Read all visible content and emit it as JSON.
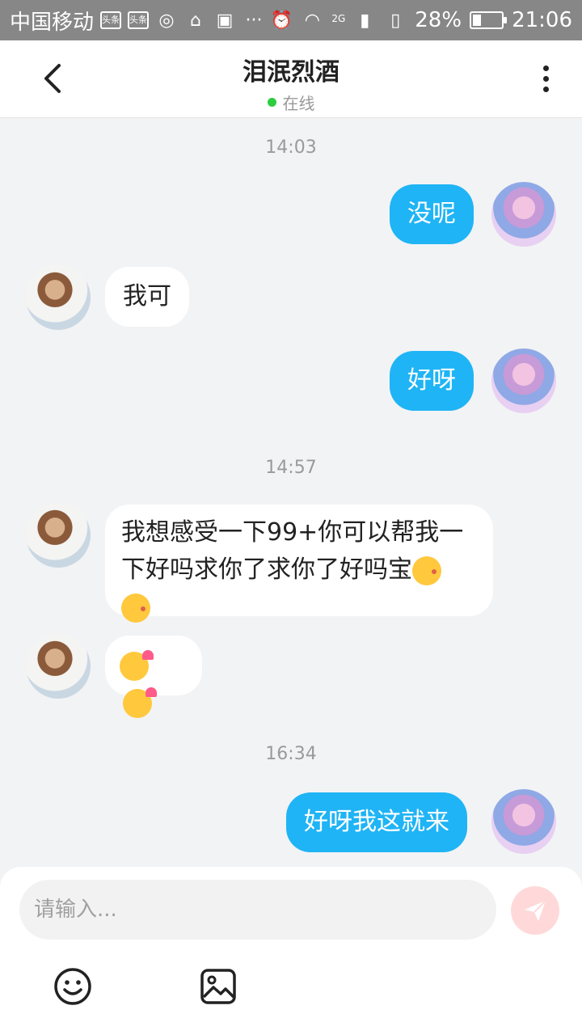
{
  "status_bar": {
    "carrier": "中国移动",
    "badge_1": "头条",
    "badge_2": "头条",
    "network": "2G",
    "battery": "28%",
    "battery_level": 0.28,
    "time": "21:06"
  },
  "header": {
    "title": "泪泯烈酒",
    "status": "在线"
  },
  "messages": {
    "ts1": "14:03",
    "m1": "没呢",
    "m2": "我可",
    "m3": "好呀",
    "ts2": "14:57",
    "m4": "我想感受一下99+你可以帮我一下好吗求你了求你了好吗宝",
    "ts3": "16:34",
    "m6": "好呀我这就来"
  },
  "input": {
    "placeholder": "请输入..."
  },
  "icons": {
    "back": "chevron-left-icon",
    "more": "more-vertical-icon",
    "send": "send-icon",
    "emoji": "smiley-icon",
    "image": "image-icon"
  },
  "colors": {
    "accent": "#1fb4f5",
    "statusbar": "#878787",
    "online": "#2ecc40"
  }
}
